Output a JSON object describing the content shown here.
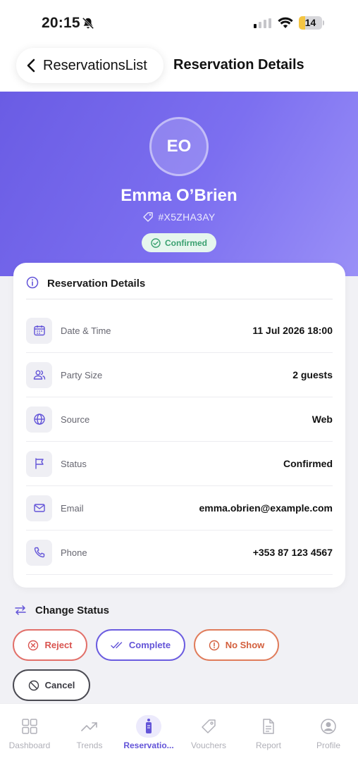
{
  "status_bar": {
    "time": "20:15",
    "battery": "14",
    "battery_level": 0.14
  },
  "nav": {
    "back_label": "ReservationsList",
    "title": "Reservation Details"
  },
  "guest": {
    "initials": "EO",
    "name": "Emma O’Brien",
    "reference": "#X5ZHA3AY",
    "status_badge": "Confirmed"
  },
  "details": {
    "title": "Reservation Details",
    "rows": [
      {
        "icon": "calendar-icon",
        "label": "Date & Time",
        "value": "11 Jul 2026 18:00"
      },
      {
        "icon": "users-icon",
        "label": "Party Size",
        "value": "2 guests"
      },
      {
        "icon": "globe-icon",
        "label": "Source",
        "value": "Web"
      },
      {
        "icon": "flag-icon",
        "label": "Status",
        "value": "Confirmed"
      },
      {
        "icon": "mail-icon",
        "label": "Email",
        "value": "emma.obrien@example.com"
      },
      {
        "icon": "phone-icon",
        "label": "Phone",
        "value": "+353 87 123 4567"
      }
    ]
  },
  "change_status": {
    "title": "Change Status",
    "actions": {
      "reject": "Reject",
      "complete": "Complete",
      "no_show": "No Show",
      "cancel": "Cancel"
    }
  },
  "tabs": [
    {
      "label": "Dashboard",
      "icon": "grid-icon"
    },
    {
      "label": "Trends",
      "icon": "trend-icon"
    },
    {
      "label": "Reservatio...",
      "icon": "reservation-icon",
      "active": true
    },
    {
      "label": "Vouchers",
      "icon": "tag-icon"
    },
    {
      "label": "Report",
      "icon": "document-icon"
    },
    {
      "label": "Profile",
      "icon": "profile-icon"
    }
  ],
  "colors": {
    "accent": "#6354d8",
    "hero_start": "#6a5ce4",
    "hero_end": "#9a90f7",
    "confirmed": "#3aa170",
    "reject": "#D9534F",
    "no_show": "#D35F3D"
  }
}
